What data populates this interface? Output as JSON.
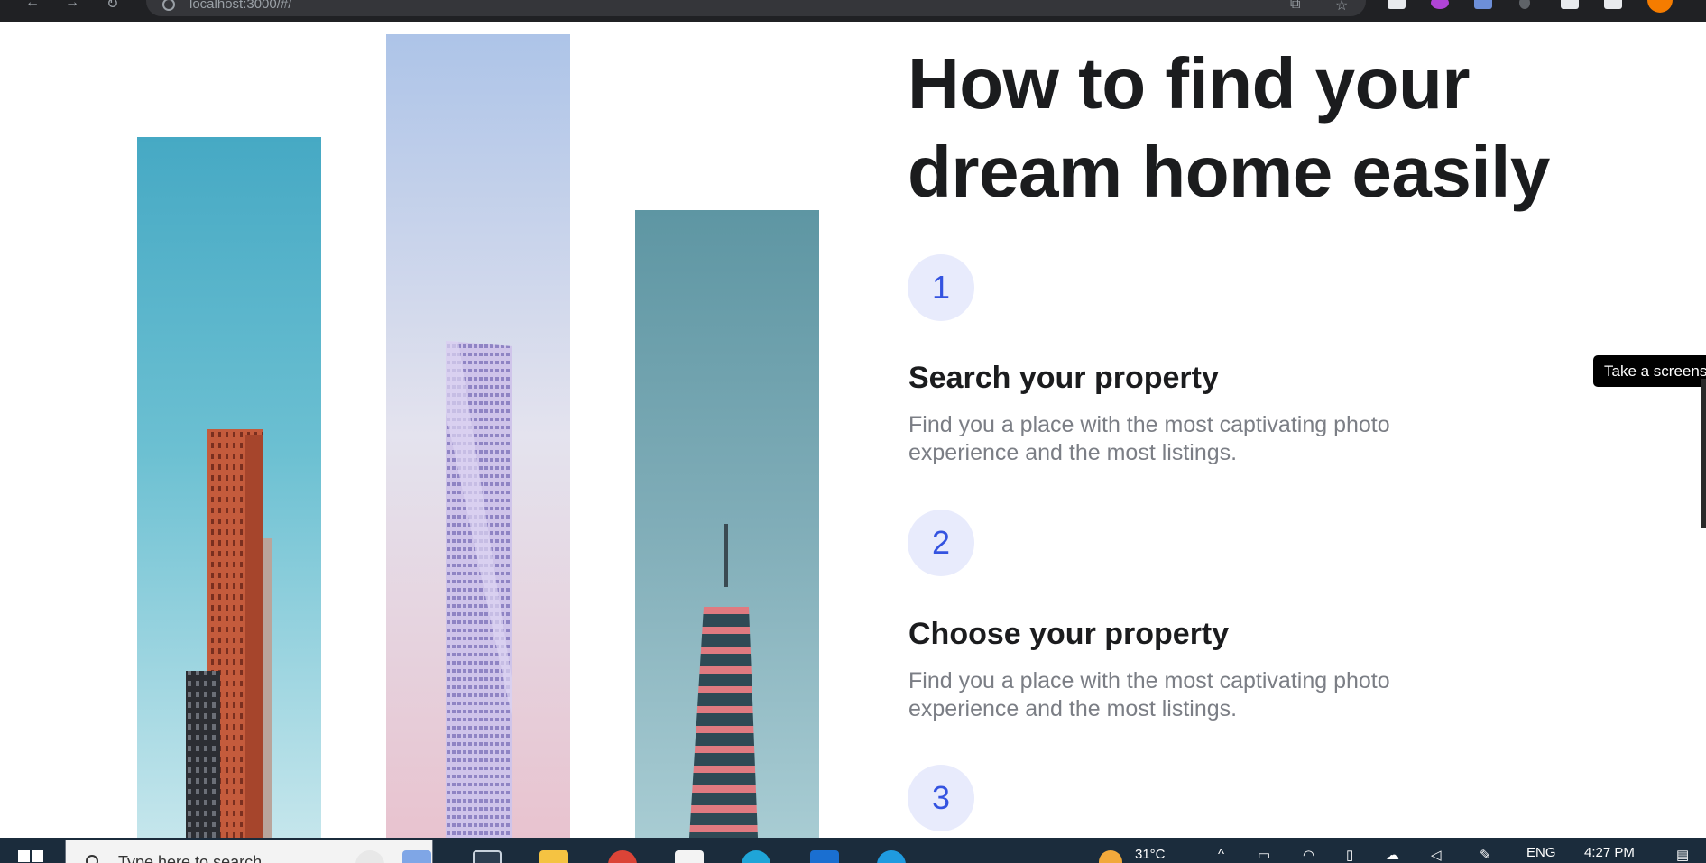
{
  "browser": {
    "url_text": "localhost:3000/#/"
  },
  "section": {
    "headline": "How to find your dream home easily",
    "steps": [
      {
        "number": "1",
        "title": "Search your property",
        "description": "Find you a place with the most captivating photo experience and the most listings."
      },
      {
        "number": "2",
        "title": "Choose your property",
        "description": "Find you a place with the most captivating photo experience and the most listings."
      },
      {
        "number": "3"
      }
    ]
  },
  "tooltip": {
    "text": "Take a screensh"
  },
  "taskbar": {
    "search_placeholder": "Type here to search",
    "temperature": "31°C",
    "language": "ENG",
    "time": "4:27 PM"
  },
  "colors": {
    "accent": "#3453e0",
    "badge_bg": "#e8ebfc",
    "heading": "#1b1c1e",
    "body_text": "#7b7e85",
    "taskbar": "#1b2c3c"
  }
}
